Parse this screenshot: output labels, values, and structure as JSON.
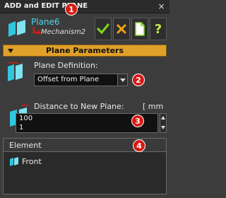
{
  "window": {
    "title": "ADD and EDIT PLANE",
    "close_label": "×"
  },
  "header": {
    "plane_name": "Plane6",
    "mechanism_name": "Mechanism2"
  },
  "toolbar": {
    "ok_icon": "checkmark-icon",
    "cancel_icon": "x-icon",
    "new_icon": "document-icon",
    "help_label": "?"
  },
  "badges": [
    "1",
    "2",
    "3",
    "4"
  ],
  "section": {
    "title": "Plane Parameters"
  },
  "definition": {
    "label": "Plane Definition:",
    "selected": "Offset from Plane"
  },
  "distance": {
    "label": "Distance to New Plane:",
    "unit": "[ mm",
    "value": "100",
    "step": "1"
  },
  "elements": {
    "header": "Element",
    "items": [
      {
        "label": "Front"
      }
    ]
  },
  "colors": {
    "accent": "#e0a12a",
    "plane_cyan": "#2fc7e0",
    "badge_red": "#d81a14"
  }
}
